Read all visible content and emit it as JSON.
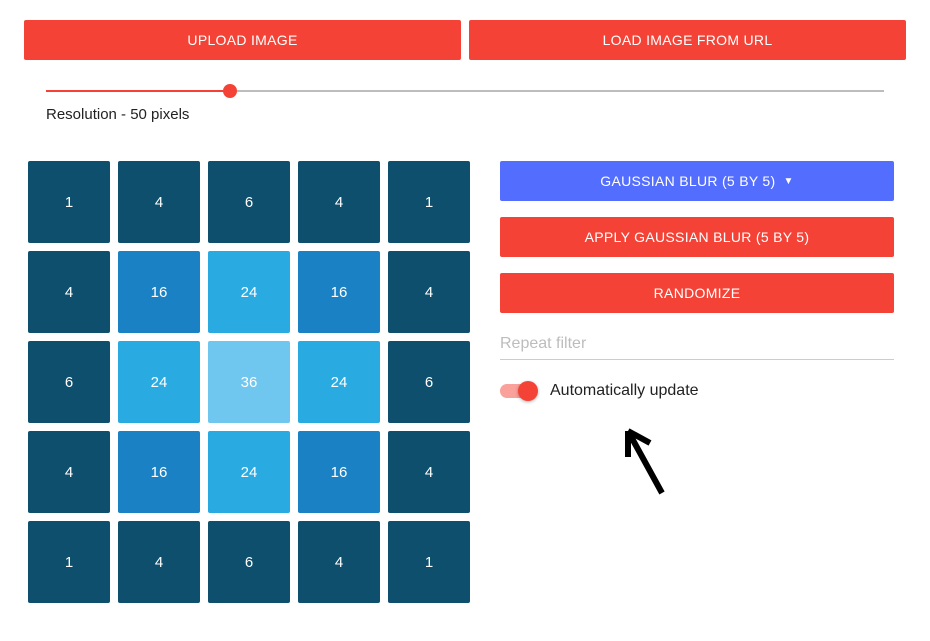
{
  "topButtons": {
    "upload": "UPLOAD IMAGE",
    "loadUrl": "LOAD IMAGE FROM URL"
  },
  "slider": {
    "label": "Resolution - 50 pixels",
    "percent": 22
  },
  "kernel": {
    "rows": [
      [
        1,
        4,
        6,
        4,
        1
      ],
      [
        4,
        16,
        24,
        16,
        4
      ],
      [
        6,
        24,
        36,
        24,
        6
      ],
      [
        4,
        16,
        24,
        16,
        4
      ],
      [
        1,
        4,
        6,
        4,
        1
      ]
    ],
    "colors": {
      "1": "#0d4f6c",
      "4": "#0d4f6c",
      "6": "#0d4f6c",
      "16": "#1a82c4",
      "24": "#29abe2",
      "36": "#6fc6ee"
    }
  },
  "right": {
    "dropdownLabel": "GAUSSIAN BLUR (5 BY 5)",
    "applyLabel": "APPLY GAUSSIAN BLUR (5 BY 5)",
    "randomizeLabel": "RANDOMIZE",
    "repeatPlaceholder": "Repeat filter",
    "toggleLabel": "Automatically update",
    "toggleOn": true
  }
}
